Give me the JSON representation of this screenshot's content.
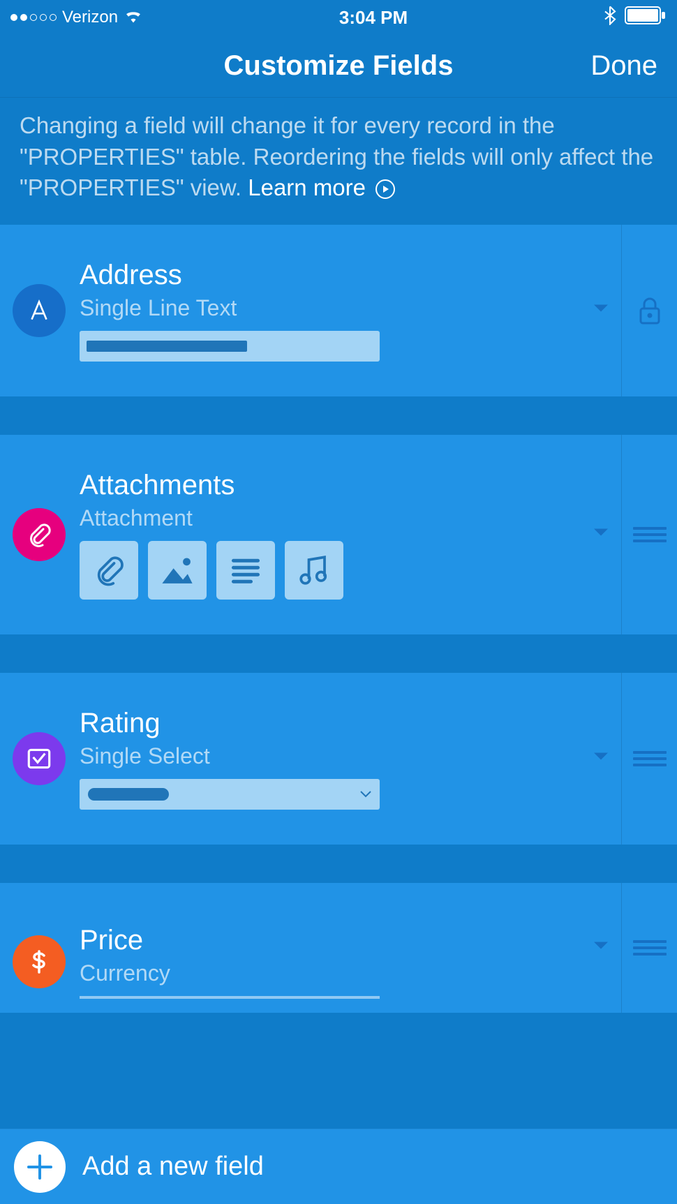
{
  "status_bar": {
    "carrier": "Verizon",
    "time": "3:04 PM"
  },
  "header": {
    "title": "Customize Fields",
    "done_label": "Done"
  },
  "info": {
    "text": "Changing a field will change it for every record in the \"PROPERTIES\" table. Reordering the fields will only affect the \"PROPERTIES\" view. ",
    "learn_more": "Learn more"
  },
  "fields": [
    {
      "name": "Address",
      "type": "Single Line Text",
      "icon": "text-a",
      "locked": true
    },
    {
      "name": "Attachments",
      "type": "Attachment",
      "icon": "paperclip",
      "locked": false
    },
    {
      "name": "Rating",
      "type": "Single Select",
      "icon": "select-check",
      "locked": false
    },
    {
      "name": "Price",
      "type": "Currency",
      "icon": "dollar",
      "locked": false
    }
  ],
  "add_field": {
    "label": "Add a new field"
  }
}
